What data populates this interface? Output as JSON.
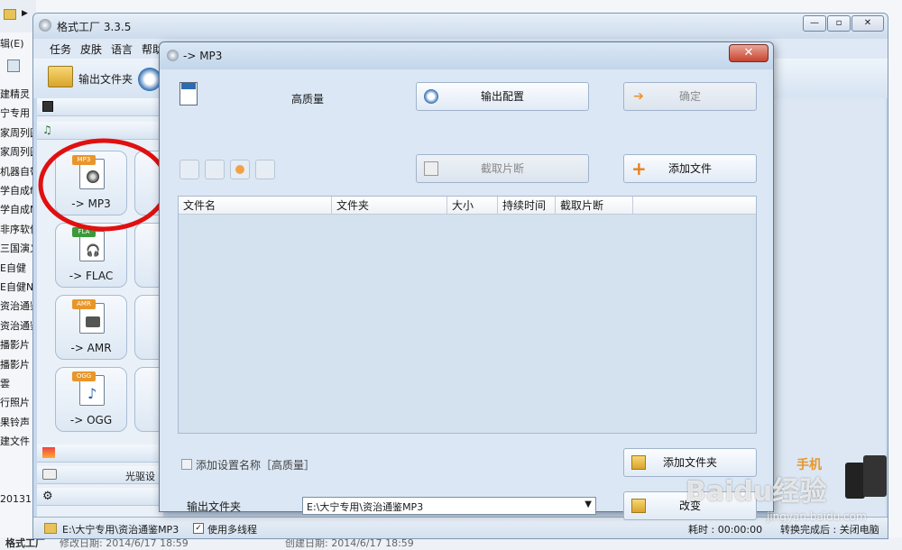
{
  "background": {
    "menu_fragment": "辑(E)",
    "left_rows": [
      "建精灵",
      "宁专用",
      "家周列圆",
      "家周列圆",
      "机器自带",
      "学自成f",
      "学自成N",
      "非序软件",
      "三国演义",
      "E自健",
      "E自健N",
      "资治通鉴",
      "资治通鉴",
      "播影片",
      "播影片",
      "雲",
      "行照片",
      "果铃声",
      "建文件"
    ],
    "left_bottom": "20131",
    "status_left": "格式工厂",
    "status_modified": "修改日期: 2014/6/17 18:59",
    "status_created": "创建日期: 2014/6/17 18:59"
  },
  "main_window": {
    "title": "格式工厂 3.3.5",
    "menu": [
      "任务",
      "皮肤",
      "语言",
      "帮助"
    ],
    "toolbar_output_folder": "输出文件夹",
    "formats": [
      {
        "tag": "MP3",
        "label": "-> MP3",
        "tag_color": "#e8962a"
      },
      {
        "tag": "FLA",
        "label": "-> FLAC",
        "tag_color": "#3a9a3a"
      },
      {
        "tag": "AMR",
        "label": "-> AMR",
        "tag_color": "#e8962a"
      },
      {
        "tag": "OGG",
        "label": "-> OGG",
        "tag_color": "#e8962a"
      }
    ],
    "disc_label": "光驱设",
    "status_path": "E:\\大宁专用\\资治通鉴MP3",
    "status_multithread": "使用多线程",
    "status_right": "耗时 : 00:00:00",
    "status_right2": "转换完成后 : 关闭电脑",
    "brand_text": "手机"
  },
  "dialog": {
    "title": "-> MP3",
    "quality_label": "高质量",
    "output_config_button": "输出配置",
    "ok_button": "确定",
    "clip_button": "截取片断",
    "add_file_button": "添加文件",
    "table_columns": [
      "文件名",
      "文件夹",
      "大小",
      "持续时间",
      "截取片断"
    ],
    "add_setting_name_label": "添加设置名称［高质量］",
    "add_folder_button": "添加文件夹",
    "output_folder_label": "输出文件夹",
    "output_folder_value": "E:\\大宁专用\\资治通鉴MP3",
    "change_button": "改变"
  },
  "watermark": {
    "brand": "Baidu经验",
    "url": "jingyan.baidu.com"
  }
}
